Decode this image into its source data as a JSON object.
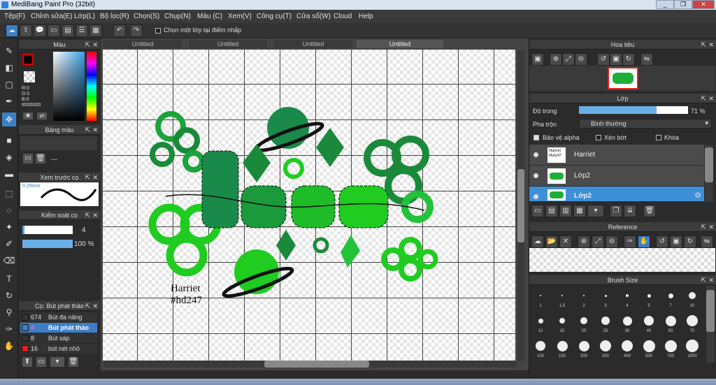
{
  "title": "MediBang Paint Pro (32bit)",
  "menu": [
    "Tệp(F)",
    "Chỉnh sửa(E)",
    "Lớp(L)",
    "Bộ lọc(R)",
    "Chọn(S)",
    "Chụp(N)",
    "Màu (C)",
    "Xem(V)",
    "Công cụ(T)",
    "Cửa sổ(W)",
    "Cloud",
    "Help"
  ],
  "toolbar": {
    "single_layer_option": "Chọn một lớp tại điểm nhấp"
  },
  "tabs": [
    "Untitled",
    "Untitled",
    "Untitled",
    "Untitled"
  ],
  "color_panel": {
    "title": "Màu",
    "r": "R:0",
    "g": "G:0",
    "b": "B:0",
    "hex": "#000000"
  },
  "palette_panel": {
    "title": "Bảng màu",
    "value": "---"
  },
  "preview_panel": {
    "title": "Xem trước cọ",
    "size": "0.29mm"
  },
  "brush_control": {
    "title": "Kiểm soát cọ",
    "size": "4",
    "opacity": "100 %"
  },
  "brush_list": {
    "title": "Cọ: Bút phát thảo",
    "items": [
      {
        "num": "674",
        "name": "Bút đa năng",
        "color": "#222222"
      },
      {
        "num": "4",
        "name": "Bút phát thảo",
        "color": "#2a2a2a"
      },
      {
        "num": "8",
        "name": "Bút sáp",
        "color": "#222222"
      },
      {
        "num": "16",
        "name": "bút nét nhỏ",
        "color": "#e02020"
      }
    ]
  },
  "canvas_text": {
    "line1": "Harriet",
    "line2": "#hd247"
  },
  "navigator": {
    "title": "Hoa tiêu"
  },
  "layer_panel": {
    "title": "Lớp",
    "opacity_label": "Độ trong",
    "opacity_value": "71 %",
    "opacity_fraction": 0.71,
    "blend_label": "Pha trộn",
    "blend_value": "Bình thường",
    "protect_alpha": "Bảo vệ alpha",
    "clipping": "Xén bớt",
    "lock": "Khóa",
    "layers": [
      {
        "name": "Harriet"
      },
      {
        "name": "Lớp2"
      },
      {
        "name": "Lớp2"
      }
    ]
  },
  "reference": {
    "title": "Reference"
  },
  "brush_size": {
    "title": "Brush Size",
    "sizes": [
      "1",
      "1.5",
      "2",
      "3",
      "4",
      "5",
      "7",
      "10",
      "12",
      "15",
      "20",
      "25",
      "30",
      "40",
      "50",
      "70",
      "100",
      "150",
      "200",
      "300",
      "400",
      "500",
      "700",
      "1000"
    ]
  }
}
